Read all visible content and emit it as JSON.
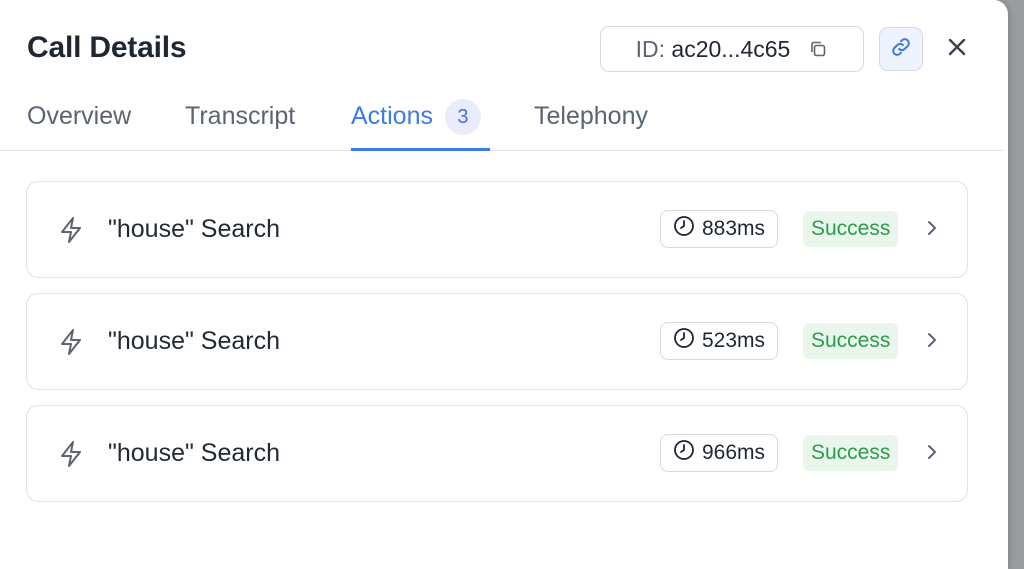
{
  "header": {
    "title": "Call Details",
    "id_label": "ID:",
    "id_value": "ac20...4c65"
  },
  "tabs": [
    {
      "label": "Overview",
      "active": false
    },
    {
      "label": "Transcript",
      "active": false
    },
    {
      "label": "Actions",
      "active": true,
      "badge": "3"
    },
    {
      "label": "Telephony",
      "active": false
    }
  ],
  "actions": [
    {
      "label": "\"house\" Search",
      "duration": "883ms",
      "status": "Success"
    },
    {
      "label": "\"house\" Search",
      "duration": "523ms",
      "status": "Success"
    },
    {
      "label": "\"house\" Search",
      "duration": "966ms",
      "status": "Success"
    }
  ],
  "colors": {
    "accent": "#3b7be6",
    "success_text": "#2f9b4f",
    "success_bg": "#e9f6ec"
  }
}
